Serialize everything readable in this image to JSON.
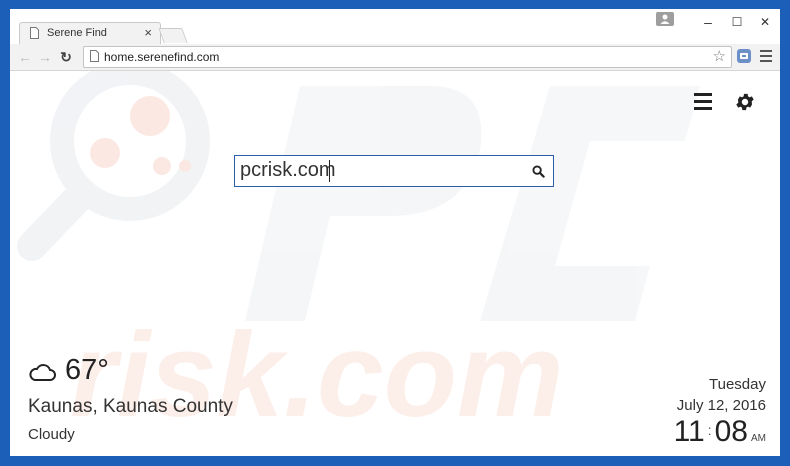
{
  "browser": {
    "tab_title": "Serene Find",
    "tab_close": "×",
    "url": "home.serenefind.com",
    "window_controls": {
      "minimize": "–",
      "maximize": "☐",
      "close": "✕"
    },
    "nav": {
      "back": "←",
      "forward": "→",
      "reload": "↻"
    },
    "star": "☆"
  },
  "page": {
    "search": {
      "value": "pcrisk.com"
    },
    "weather": {
      "temperature": "67°",
      "location": "Kaunas, Kaunas County",
      "condition": "Cloudy",
      "icon": "cloud-icon"
    },
    "datetime": {
      "day": "Tuesday",
      "date": "July 12, 2016",
      "hour": "11",
      "separator": ":",
      "minute": "08",
      "ampm": "AM"
    }
  },
  "colors": {
    "frame_blue": "#1c5fb8",
    "search_border": "#2b5ea8",
    "watermark_red": "#f4b7a8",
    "watermark_grey": "#e9ecef"
  }
}
